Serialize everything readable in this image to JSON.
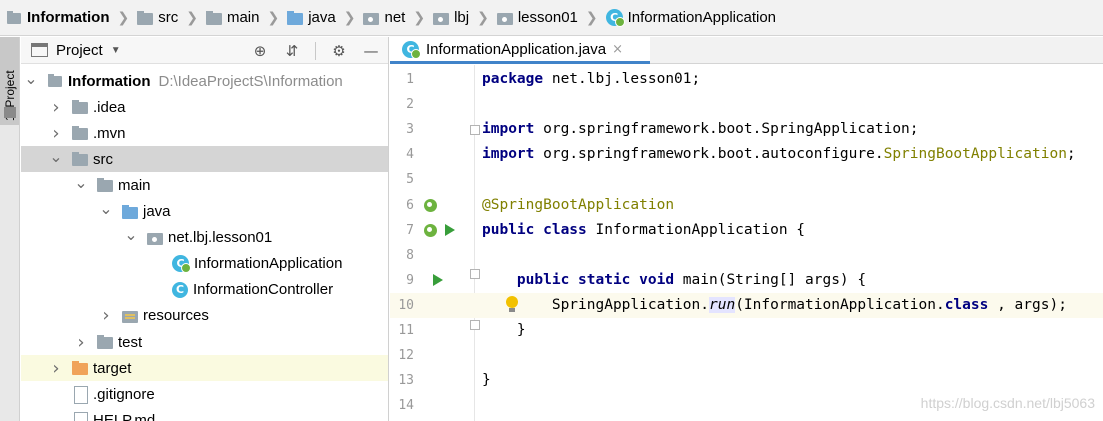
{
  "breadcrumb": {
    "items": [
      {
        "label": "Information",
        "icon": "module-icon",
        "bold": true
      },
      {
        "label": "src",
        "icon": "folder-icon"
      },
      {
        "label": "main",
        "icon": "folder-icon"
      },
      {
        "label": "java",
        "icon": "source-folder-icon"
      },
      {
        "label": "net",
        "icon": "package-icon"
      },
      {
        "label": "lbj",
        "icon": "package-icon"
      },
      {
        "label": "lesson01",
        "icon": "package-icon"
      },
      {
        "label": "InformationApplication",
        "icon": "spring-boot-class-icon"
      }
    ]
  },
  "tool_strip": {
    "label": "1: Project"
  },
  "project_panel": {
    "title": "Project",
    "tools": [
      "locate-icon",
      "collapse-all-icon",
      "gear-icon",
      "minimize-icon"
    ]
  },
  "tree": [
    {
      "label": "Information",
      "path": "D:\\IdeaProjectS\\Information",
      "level": 0,
      "arrow": "down",
      "icon": "module",
      "bold": true
    },
    {
      "label": ".idea",
      "level": 1,
      "arrow": "right",
      "icon": "folder"
    },
    {
      "label": ".mvn",
      "level": 1,
      "arrow": "right",
      "icon": "folder"
    },
    {
      "label": "src",
      "level": 1,
      "arrow": "down",
      "icon": "folder",
      "selected": true
    },
    {
      "label": "main",
      "level": 2,
      "arrow": "down",
      "icon": "folder"
    },
    {
      "label": "java",
      "level": 3,
      "arrow": "down",
      "icon": "folder-blue"
    },
    {
      "label": "net.lbj.lesson01",
      "level": 4,
      "arrow": "down",
      "icon": "package"
    },
    {
      "label": "InformationApplication",
      "level": 5,
      "arrow": "none",
      "icon": "springclass"
    },
    {
      "label": "InformationController",
      "level": 5,
      "arrow": "none",
      "icon": "class"
    },
    {
      "label": "resources",
      "level": 3,
      "arrow": "right",
      "icon": "resources"
    },
    {
      "label": "test",
      "level": 2,
      "arrow": "right",
      "icon": "folder"
    },
    {
      "label": "target",
      "level": 1,
      "arrow": "right",
      "icon": "folder-orange",
      "highlight": true
    },
    {
      "label": ".gitignore",
      "level": 1,
      "arrow": "none",
      "icon": "file"
    },
    {
      "label": "HELP.md",
      "level": 1,
      "arrow": "none",
      "icon": "file"
    }
  ],
  "editor": {
    "tab_label": "InformationApplication.java",
    "tab_close": "×",
    "current_line": 10,
    "lines": [
      {
        "n": "1",
        "segs": [
          [
            "kw",
            "package"
          ],
          [
            "",
            "net.lbj.lesson01;"
          ]
        ]
      },
      {
        "n": "2",
        "segs": []
      },
      {
        "n": "3",
        "segs": [
          [
            "kw",
            "import"
          ],
          [
            "",
            "org.springframework.boot.SpringApplication;"
          ]
        ]
      },
      {
        "n": "4",
        "segs": [
          [
            "kw",
            "import"
          ],
          [
            "",
            "org.springframework.boot.autoconfigure."
          ],
          [
            "anno",
            "SpringBootApplication"
          ],
          [
            "",
            ";"
          ]
        ]
      },
      {
        "n": "5",
        "segs": []
      },
      {
        "n": "6",
        "segs": [
          [
            "anno",
            "@SpringBootApplication"
          ]
        ]
      },
      {
        "n": "7",
        "segs": [
          [
            "kw",
            "public class"
          ],
          [
            "",
            "InformationApplication {"
          ]
        ]
      },
      {
        "n": "8",
        "segs": []
      },
      {
        "n": "9",
        "segs": [
          [
            "",
            "    "
          ],
          [
            "kw",
            "public static void"
          ],
          [
            "",
            "main(String[] args) {"
          ]
        ]
      },
      {
        "n": "10",
        "segs": [
          [
            "",
            "        SpringApplication."
          ],
          [
            "run",
            "run"
          ],
          [
            "",
            "(InformationApplication."
          ],
          [
            "kw",
            "class"
          ],
          [
            "",
            ", args);"
          ]
        ]
      },
      {
        "n": "11",
        "segs": [
          [
            "",
            "    }"
          ]
        ]
      },
      {
        "n": "12",
        "segs": []
      },
      {
        "n": "13",
        "segs": [
          [
            "",
            "}"
          ]
        ]
      },
      {
        "n": "14",
        "segs": []
      }
    ]
  },
  "watermark": "https://blog.csdn.net/lbj5063"
}
